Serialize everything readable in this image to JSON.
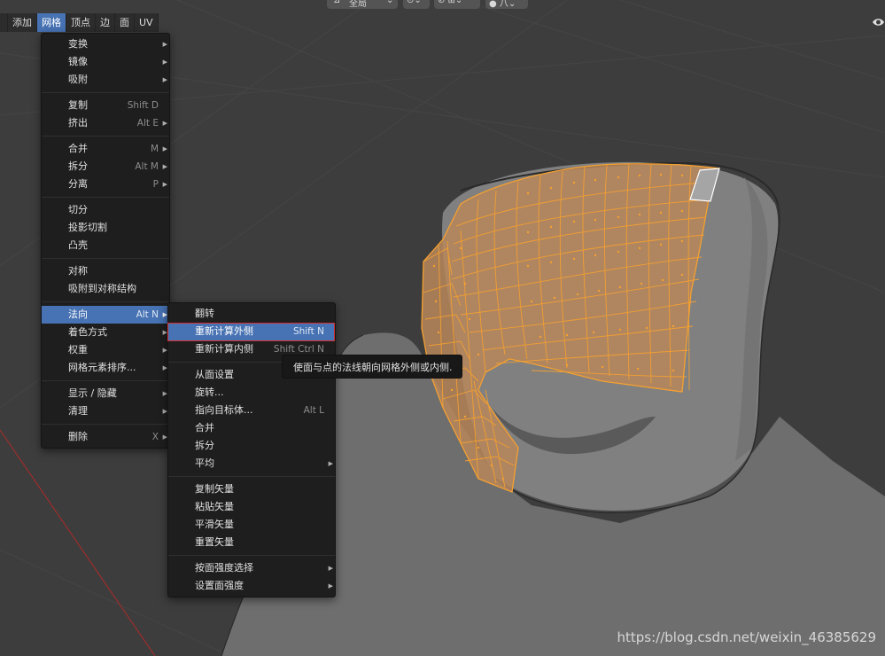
{
  "header": {
    "selector_label": "全局"
  },
  "menubar": {
    "items": [
      "添加",
      "网格",
      "顶点",
      "边",
      "面",
      "UV"
    ],
    "active_index": 1
  },
  "mesh_menu": {
    "groups": [
      [
        {
          "label": "变换",
          "shortcut": "",
          "submenu": true
        },
        {
          "label": "镜像",
          "shortcut": "",
          "submenu": true
        },
        {
          "label": "吸附",
          "shortcut": "",
          "submenu": true
        }
      ],
      [
        {
          "label": "复制",
          "shortcut": "Shift D",
          "submenu": false
        },
        {
          "label": "挤出",
          "shortcut": "Alt E",
          "submenu": true
        }
      ],
      [
        {
          "label": "合并",
          "shortcut": "M",
          "submenu": true
        },
        {
          "label": "拆分",
          "shortcut": "Alt M",
          "submenu": true
        },
        {
          "label": "分离",
          "shortcut": "P",
          "submenu": true
        }
      ],
      [
        {
          "label": "切分",
          "shortcut": "",
          "submenu": false
        },
        {
          "label": "投影切割",
          "shortcut": "",
          "submenu": false
        },
        {
          "label": "凸壳",
          "shortcut": "",
          "submenu": false
        }
      ],
      [
        {
          "label": "对称",
          "shortcut": "",
          "submenu": false
        },
        {
          "label": "吸附到对称结构",
          "shortcut": "",
          "submenu": false
        }
      ],
      [
        {
          "label": "法向",
          "shortcut": "Alt N",
          "submenu": true,
          "highlighted": true
        },
        {
          "label": "着色方式",
          "shortcut": "",
          "submenu": true
        },
        {
          "label": "权重",
          "shortcut": "",
          "submenu": true
        },
        {
          "label": "网格元素排序...",
          "shortcut": "",
          "submenu": true
        }
      ],
      [
        {
          "label": "显示 / 隐藏",
          "shortcut": "",
          "submenu": true
        },
        {
          "label": "清理",
          "shortcut": "",
          "submenu": true
        }
      ],
      [
        {
          "label": "删除",
          "shortcut": "X",
          "submenu": true
        }
      ]
    ]
  },
  "normals_menu": {
    "groups": [
      [
        {
          "label": "翻转",
          "shortcut": "",
          "submenu": false
        },
        {
          "label": "重新计算外侧",
          "shortcut": "Shift N",
          "submenu": false,
          "highlighted": true
        },
        {
          "label": "重新计算内侧",
          "shortcut": "Shift Ctrl N",
          "submenu": false
        }
      ],
      [
        {
          "label": "从面设置",
          "shortcut": "",
          "submenu": false
        },
        {
          "label": "旋转...",
          "shortcut": "",
          "submenu": false
        },
        {
          "label": "指向目标体...",
          "shortcut": "Alt L",
          "submenu": false
        },
        {
          "label": "合并",
          "shortcut": "",
          "submenu": false
        },
        {
          "label": "拆分",
          "shortcut": "",
          "submenu": false
        },
        {
          "label": "平均",
          "shortcut": "",
          "submenu": true
        }
      ],
      [
        {
          "label": "复制矢量",
          "shortcut": "",
          "submenu": false
        },
        {
          "label": "粘贴矢量",
          "shortcut": "",
          "submenu": false
        },
        {
          "label": "平滑矢量",
          "shortcut": "",
          "submenu": false
        },
        {
          "label": "重置矢量",
          "shortcut": "",
          "submenu": false
        }
      ],
      [
        {
          "label": "按面强度选择",
          "shortcut": "",
          "submenu": true
        },
        {
          "label": "设置面强度",
          "shortcut": "",
          "submenu": true
        }
      ]
    ]
  },
  "tooltip": {
    "text": "使面与点的法线朝向网格外侧或内侧."
  },
  "watermark": "https://blog.csdn.net/weixin_46385629",
  "colors": {
    "background": "#3d3d3d",
    "mesh_body": "#7a7a7a",
    "selection_orange": "#f5a030",
    "highlight_blue": "#4772b3",
    "menu_bg": "#1e1e1e",
    "red_axis": "#9b2d2d"
  }
}
